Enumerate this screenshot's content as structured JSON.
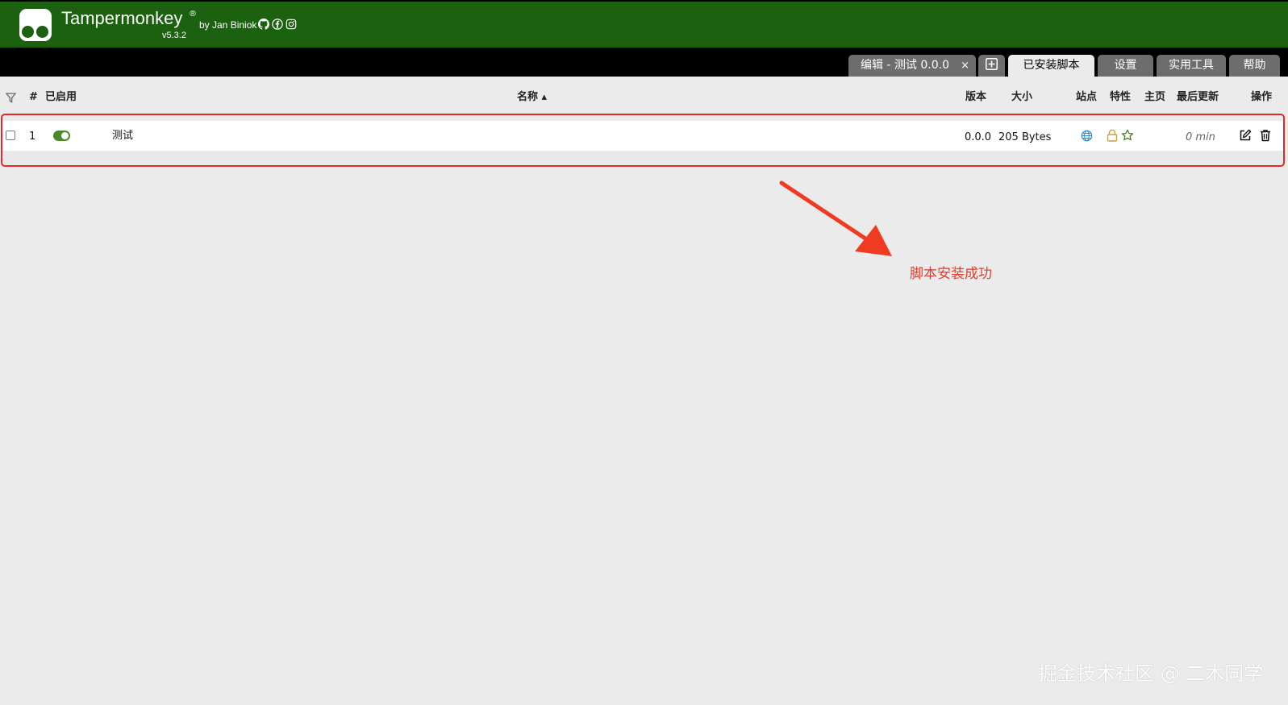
{
  "header": {
    "brand": "Tampermonkey",
    "reg_mark": "®",
    "byline": "by Jan Biniok",
    "version": "v5.3.2",
    "social_icons": [
      "github-icon",
      "facebook-icon",
      "instagram-icon"
    ]
  },
  "tabs": [
    {
      "label": "编辑 - 测试 0.0.0",
      "close": "×",
      "active": false
    },
    {
      "label": "",
      "icon": "new-script-icon",
      "active": false
    },
    {
      "label": "已安装脚本",
      "active": true
    },
    {
      "label": "设置",
      "active": false
    },
    {
      "label": "实用工具",
      "active": false
    },
    {
      "label": "帮助",
      "active": false
    }
  ],
  "table": {
    "columns": {
      "filter": "filter-icon",
      "index": "#",
      "enabled": "已启用",
      "name": "名称 ▴",
      "version": "版本",
      "size": "大小",
      "sites": "站点",
      "features": "特性",
      "homepage": "主页",
      "last_updated": "最后更新",
      "actions": "操作"
    },
    "rows": [
      {
        "index": "1",
        "enabled": true,
        "name": "测试",
        "version": "0.0.0",
        "size": "205 Bytes",
        "sites_icon": "globe-icon",
        "feature_icons": [
          "lock-icon",
          "star-icon"
        ],
        "last_updated": "0 min",
        "action_icons": [
          "edit-icon",
          "trash-icon"
        ]
      }
    ]
  },
  "annotation": "脚本安装成功",
  "watermark": "掘金技术社区 @ 二木同学",
  "colors": {
    "header_bg": "#1c610f",
    "tab_bg": "#6d6d6d",
    "page_bg": "#ebebeb",
    "accent_red": "#e8262b",
    "toggle_on": "#4a8a2a"
  }
}
